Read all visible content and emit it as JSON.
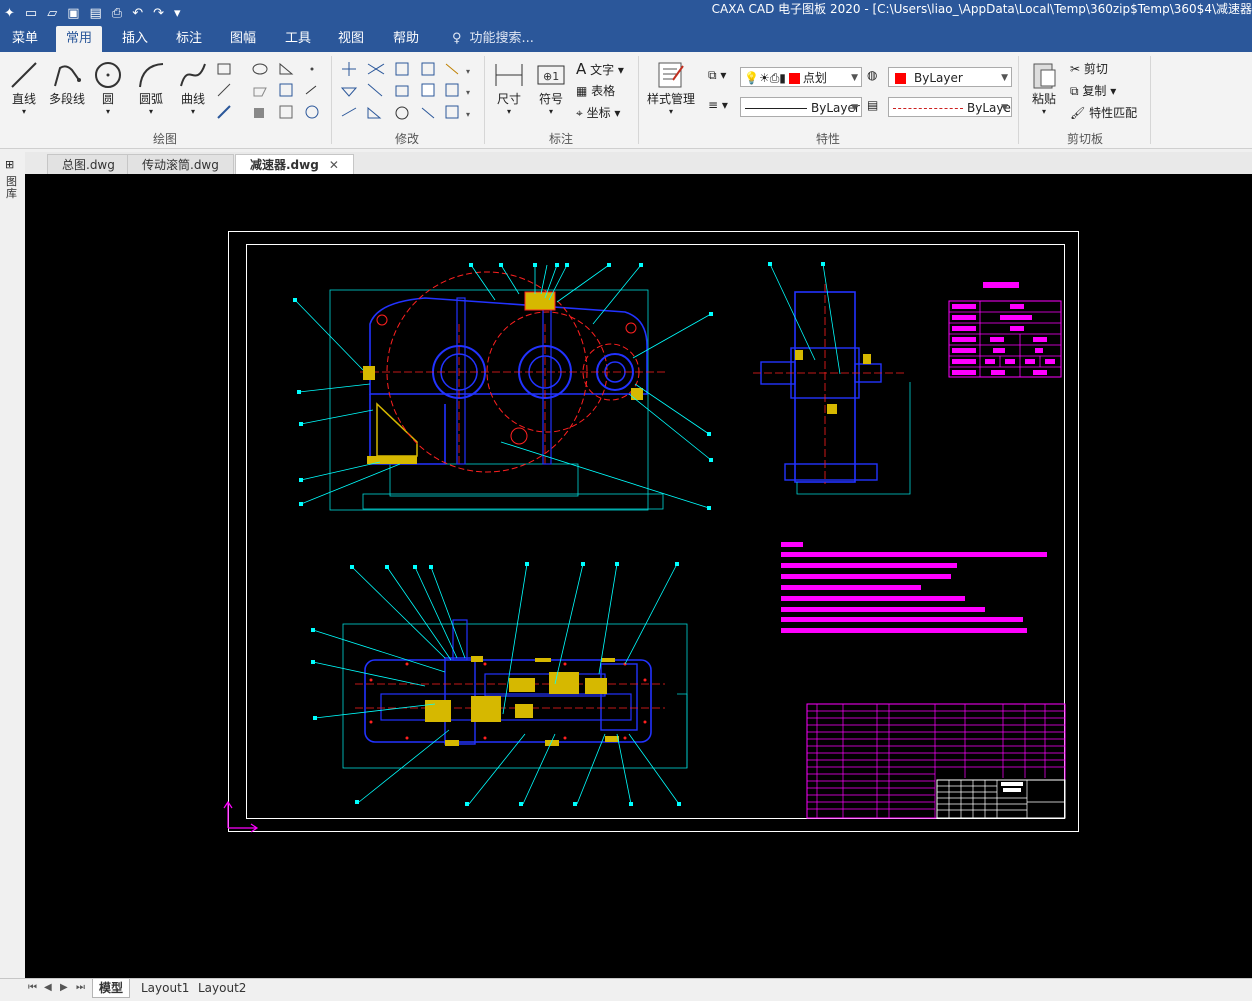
{
  "window": {
    "title": "CAXA CAD 电子图板 2020 - [C:\\Users\\liao_\\AppData\\Local\\Temp\\360zip$Temp\\360$4\\减速器"
  },
  "menu": {
    "tabs": [
      "菜单",
      "常用",
      "插入",
      "标注",
      "图幅",
      "工具",
      "视图",
      "帮助"
    ],
    "active": "常用",
    "search_placeholder": "功能搜索..."
  },
  "ribbon": {
    "draw": {
      "label": "绘图",
      "line": "直线",
      "polyline": "多段线",
      "circle": "圆",
      "arc": "圆弧",
      "curve": "曲线"
    },
    "modify": {
      "label": "修改"
    },
    "annotate": {
      "label": "标注",
      "dimension": "尺寸",
      "symbol": "符号",
      "text": "文字",
      "table": "表格",
      "coordinate": "坐标"
    },
    "properties": {
      "label": "特性",
      "style_manager": "样式管理",
      "linetype_value": "点划",
      "color_value": "ByLayer",
      "linewidth_value": "ByLayer",
      "layer_linetype_value": "ByLaye"
    },
    "clipboard": {
      "label": "剪切板",
      "paste": "粘贴",
      "cut": "剪切",
      "copy": "复制",
      "match": "特性匹配"
    }
  },
  "documents": {
    "tabs": [
      "总图.dwg",
      "传动滚筒.dwg",
      "减速器.dwg"
    ],
    "active": "减速器.dwg",
    "left_panel_label": "图库"
  },
  "layouts": {
    "tabs": [
      "模型",
      "Layout1",
      "Layout2"
    ],
    "active": "模型"
  },
  "colors": {
    "ribbon_blue": "#2b579a",
    "canvas": "#000000",
    "cad_blue": "#1f2bff",
    "cad_red": "#ff2020",
    "cad_cyan": "#00ffff",
    "cad_magenta": "#ff00ff",
    "cad_yellow": "#ffff00",
    "cad_white": "#ffffff"
  }
}
